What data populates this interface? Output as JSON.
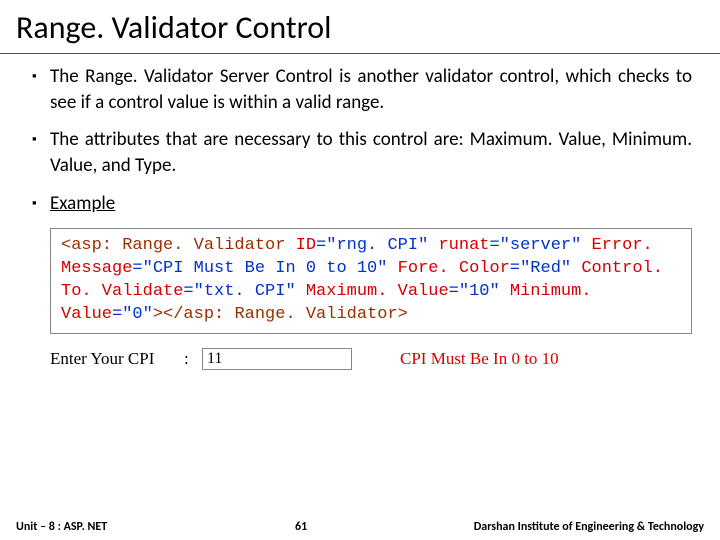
{
  "title": "Range. Validator Control",
  "bullets": {
    "b1": "The Range. Validator Server Control is another validator control, which checks to see if a control value is within a valid range.",
    "b2": "The attributes that are necessary to this control are: Maximum. Value, Minimum. Value, and Type.",
    "b3_label": "Example"
  },
  "code": {
    "open": "<asp: Range. Validator ",
    "attr_id": "ID",
    "val_id": "=\"rng. CPI\"",
    "attr_runat": "runat",
    "val_runat": "=\"server\"",
    "attr_err": "Error. Message",
    "val_err": "=\"CPI Must Be In 0 to 10\"",
    "attr_fore": "Fore. Color",
    "val_fore": "=\"Red\"",
    "attr_ctv": "Control. To. Validate",
    "val_ctv": "=\"txt. CPI\"",
    "attr_max": "Maximum. Value",
    "val_max": "=\"10\"",
    "attr_min": "Minimum. Value",
    "val_min": "=\"0\"",
    "close": "></asp: Range. Validator>"
  },
  "demo": {
    "label": "Enter Your CPI",
    "colon": ":",
    "input_value": "11",
    "error": "CPI Must Be In 0 to 10"
  },
  "footer": {
    "left": "Unit – 8 : ASP. NET",
    "center": "61",
    "right": "Darshan Institute of Engineering & Technology"
  }
}
